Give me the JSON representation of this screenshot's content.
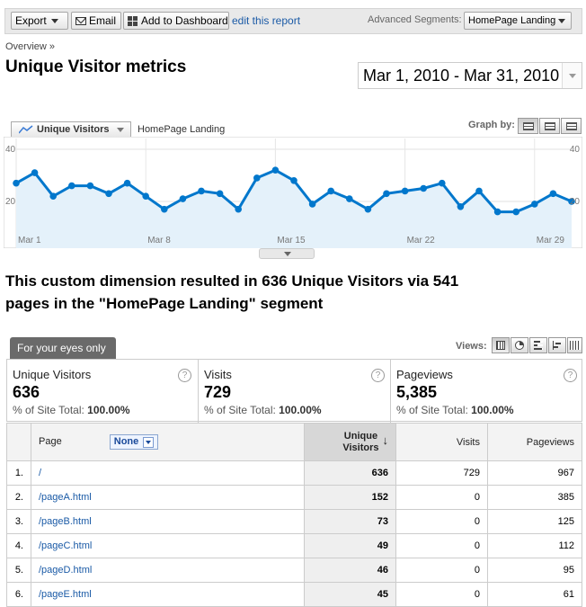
{
  "toolbar": {
    "export_label": "Export",
    "email_label": "Email",
    "dashboard_label": "Add to Dashboard",
    "edit_link": "edit this report",
    "segments_label": "Advanced Segments:",
    "segment_value": "HomePage Landing"
  },
  "breadcrumb": "Overview »",
  "page_title": "Unique Visitor metrics",
  "date_range": "Mar 1, 2010 - Mar 31, 2010",
  "graph": {
    "metric_label": "Unique Visitors",
    "segment_label": "HomePage Landing",
    "graph_by_label": "Graph by:"
  },
  "chart_data": {
    "type": "area",
    "series": [
      {
        "name": "Unique Visitors",
        "values": [
          27,
          31,
          22,
          26,
          26,
          23,
          27,
          22,
          17,
          21,
          24,
          23,
          17,
          29,
          32,
          28,
          19,
          24,
          21,
          17,
          23,
          24,
          25,
          27,
          18,
          24,
          16,
          16,
          19,
          23,
          20
        ]
      }
    ],
    "x_labels": [
      "Mar 1",
      "Mar 8",
      "Mar 15",
      "Mar 22",
      "Mar 29"
    ],
    "y_ticks": [
      "40",
      "20"
    ],
    "ylim": [
      0,
      40
    ],
    "line_color": "#0077cc",
    "fill_color": "#e4f1fa"
  },
  "summary_text_line1": "This custom dimension resulted in 636 Unique Visitors via 541",
  "summary_text_line2": "pages in the \"HomePage Landing\" segment",
  "tab_label": "For your eyes only",
  "views_label": "Views:",
  "cards": [
    {
      "label": "Unique Visitors",
      "value": "636",
      "sub_prefix": "% of Site Total:",
      "sub_value": "100.00%"
    },
    {
      "label": "Visits",
      "value": "729",
      "sub_prefix": "% of Site Total:",
      "sub_value": "100.00%"
    },
    {
      "label": "Pageviews",
      "value": "5,385",
      "sub_prefix": "% of Site Total:",
      "sub_value": "100.00%"
    }
  ],
  "help_glyph": "?",
  "table": {
    "headers": {
      "page": "Page",
      "secondary": "None",
      "unique_line1": "Unique",
      "unique_line2": "Visitors",
      "visits": "Visits",
      "pageviews": "Pageviews"
    },
    "rows": [
      {
        "idx": "1.",
        "page": "/",
        "unique": "636",
        "visits": "729",
        "pageviews": "967"
      },
      {
        "idx": "2.",
        "page": "/pageA.html",
        "unique": "152",
        "visits": "0",
        "pageviews": "385"
      },
      {
        "idx": "3.",
        "page": "/pageB.html",
        "unique": "73",
        "visits": "0",
        "pageviews": "125"
      },
      {
        "idx": "4.",
        "page": "/pageC.html",
        "unique": "49",
        "visits": "0",
        "pageviews": "112"
      },
      {
        "idx": "5.",
        "page": "/pageD.html",
        "unique": "46",
        "visits": "0",
        "pageviews": "95"
      },
      {
        "idx": "6.",
        "page": "/pageE.html",
        "unique": "45",
        "visits": "0",
        "pageviews": "61"
      }
    ]
  }
}
